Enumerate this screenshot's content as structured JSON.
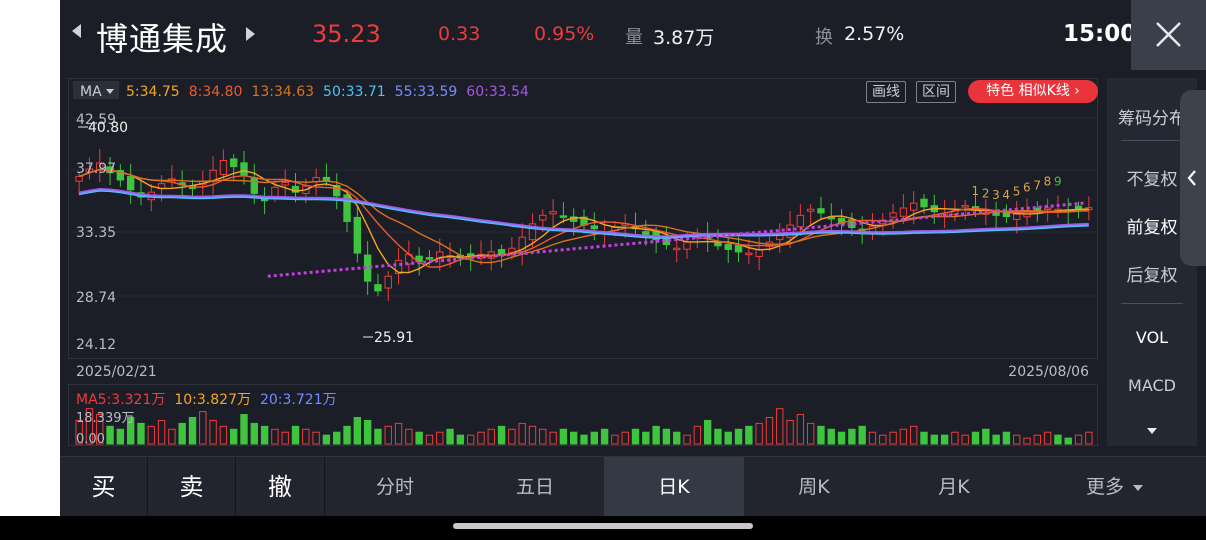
{
  "header": {
    "stock_name": "博通集成",
    "price": "35.23",
    "change": "0.33",
    "change_pct": "0.95%",
    "volume_label": "量",
    "volume_value": "3.87万",
    "turnover_label": "换",
    "turnover_value": "2.57%",
    "time": "15:00"
  },
  "toolbar": {
    "ma_label": "MA",
    "ma_items": [
      {
        "text": "5:34.75",
        "color": "#f5a623"
      },
      {
        "text": "8:34.80",
        "color": "#ee5a2f"
      },
      {
        "text": "13:34.63",
        "color": "#d9731f"
      },
      {
        "text": "50:33.71",
        "color": "#4fc3f7"
      },
      {
        "text": "55:33.59",
        "color": "#7b8cff"
      },
      {
        "text": "60:33.54",
        "color": "#a259e6"
      }
    ],
    "draw_line": "画线",
    "interval": "区间",
    "special": "特色  相似K线 ›"
  },
  "chart": {
    "y_ticks": [
      "42.59",
      "37.97",
      "33.35",
      "28.74",
      "24.12"
    ],
    "high_label": "40.80",
    "low_label": "25.91",
    "date_start": "2025/02/21",
    "date_end": "2025/08/06",
    "sequence_labels": [
      "1",
      "2",
      "3",
      "4",
      "5",
      "6",
      "7",
      "8",
      "9"
    ]
  },
  "volume": {
    "ma_items": [
      {
        "text": "MA5:3.321万",
        "color": "#ee3b3b"
      },
      {
        "text": "10:3.827万",
        "color": "#f5a623"
      },
      {
        "text": "20:3.721万",
        "color": "#6f8cff"
      }
    ],
    "max_label": "18.339万",
    "min_label": "0.00"
  },
  "side": {
    "chip": "筹码分布",
    "no_adjust": "不复权",
    "forward_adjust": "前复权",
    "back_adjust": "后复权",
    "vol": "VOL",
    "macd": "MACD"
  },
  "tabs": {
    "buy": "买",
    "sell": "卖",
    "cancel": "撤",
    "intraday": "分时",
    "five_day": "五日",
    "daily_k": "日K",
    "weekly_k": "周K",
    "monthly_k": "月K",
    "more": "更多"
  },
  "chart_data": {
    "type": "candlestick",
    "x_range": [
      "2025/02/21",
      "2025/08/06"
    ],
    "ylim": [
      24.12,
      42.59
    ],
    "y_ticks": [
      42.59,
      37.97,
      33.35,
      28.74,
      24.12
    ],
    "high": 40.8,
    "low": 25.91,
    "last_close": 35.23,
    "ma": [
      {
        "name": "MA5",
        "value": 34.75
      },
      {
        "name": "MA8",
        "value": 34.8
      },
      {
        "name": "MA13",
        "value": 34.63
      },
      {
        "name": "MA50",
        "value": 33.71
      },
      {
        "name": "MA55",
        "value": 33.59
      },
      {
        "name": "MA60",
        "value": 33.54
      }
    ],
    "close_series": [
      37.8,
      38.4,
      38.9,
      38.1,
      37.5,
      36.7,
      36.1,
      36.5,
      37.2,
      37.6,
      37.1,
      36.8,
      37.4,
      38.3,
      39.1,
      38.6,
      37.9,
      36.4,
      35.8,
      36.9,
      37.3,
      36.5,
      37.0,
      37.7,
      37.4,
      36.2,
      34.1,
      31.5,
      29.2,
      28.4,
      29.6,
      30.9,
      31.4,
      30.8,
      31.0,
      31.6,
      31.3,
      31.1,
      31.2,
      31.4,
      31.6,
      31.3,
      31.9,
      32.8,
      33.9,
      34.6,
      34.9,
      34.5,
      34.1,
      33.8,
      33.5,
      33.2,
      33.6,
      33.9,
      33.5,
      33.0,
      32.6,
      32.2,
      31.9,
      32.4,
      33.0,
      32.7,
      32.1,
      31.8,
      31.6,
      31.5,
      31.8,
      32.4,
      33.1,
      33.8,
      34.6,
      35.1,
      34.8,
      34.3,
      33.9,
      33.6,
      33.4,
      33.7,
      34.2,
      34.8,
      35.2,
      35.6,
      35.3,
      34.9,
      34.7,
      35.0,
      35.4,
      35.1,
      34.8,
      34.6,
      34.5,
      34.7,
      34.9,
      35.0,
      35.2,
      35.1,
      35.0,
      35.1,
      35.23
    ],
    "trendline": {
      "from": [
        0.19,
        29.6
      ],
      "to": [
        0.99,
        35.6
      ],
      "color": "#c23fe0",
      "style": "dotted"
    },
    "volume_max": 18.339,
    "volume_series": [
      8,
      12,
      10,
      6,
      5,
      9,
      7,
      6,
      8,
      5,
      7,
      9,
      11,
      8,
      6,
      5,
      10,
      7,
      6,
      5,
      4,
      6,
      5,
      4,
      3,
      4,
      6,
      9,
      8,
      5,
      6,
      7,
      5,
      4,
      3,
      4,
      5,
      3,
      3,
      4,
      5,
      6,
      5,
      7,
      6,
      5,
      4,
      5,
      4,
      3,
      4,
      5,
      3,
      4,
      5,
      4,
      6,
      5,
      4,
      3,
      6,
      8,
      5,
      4,
      5,
      6,
      7,
      9,
      12,
      8,
      10,
      7,
      6,
      5,
      4,
      5,
      6,
      4,
      3,
      4,
      5,
      6,
      4,
      3,
      3,
      4,
      3,
      4,
      5,
      3,
      4,
      3,
      2,
      3,
      4,
      3,
      2,
      3,
      4
    ]
  }
}
